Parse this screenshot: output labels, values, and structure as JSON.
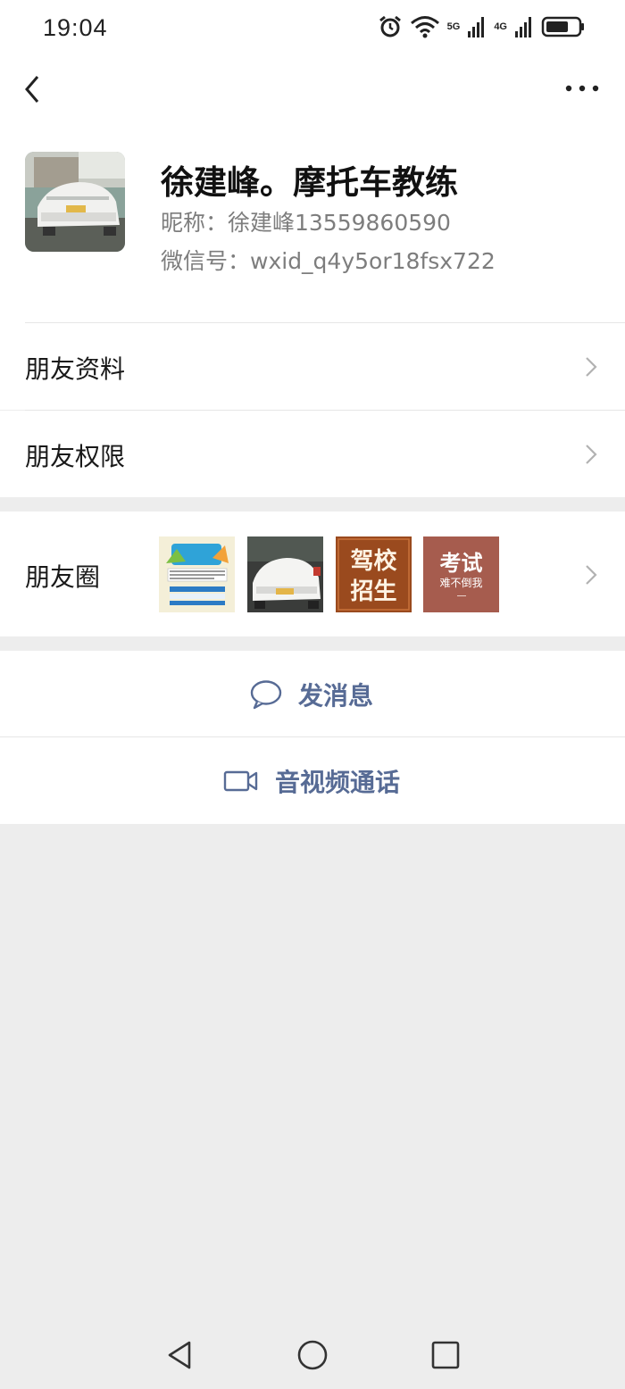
{
  "status_bar": {
    "time": "19:04",
    "signal_5g": "5G",
    "signal_4g": "4G"
  },
  "profile": {
    "display_name": "徐建峰。摩托车教练",
    "nickname": "昵称：徐建峰13559860590",
    "wechat_id": "微信号：wxid_q4y5or18fsx722"
  },
  "rows": {
    "friend_info": "朋友资料",
    "friend_permissions": "朋友权限",
    "moments": "朋友圈"
  },
  "moments_thumbs": {
    "thumb3_line1": "驾校",
    "thumb3_line2": "招生",
    "thumb4_line1": "考试",
    "thumb4_line2": "难不倒我"
  },
  "actions": {
    "send_message": "发消息",
    "video_call": "音视频通话"
  },
  "colors": {
    "link": "#576b95",
    "background": "#ededed"
  }
}
